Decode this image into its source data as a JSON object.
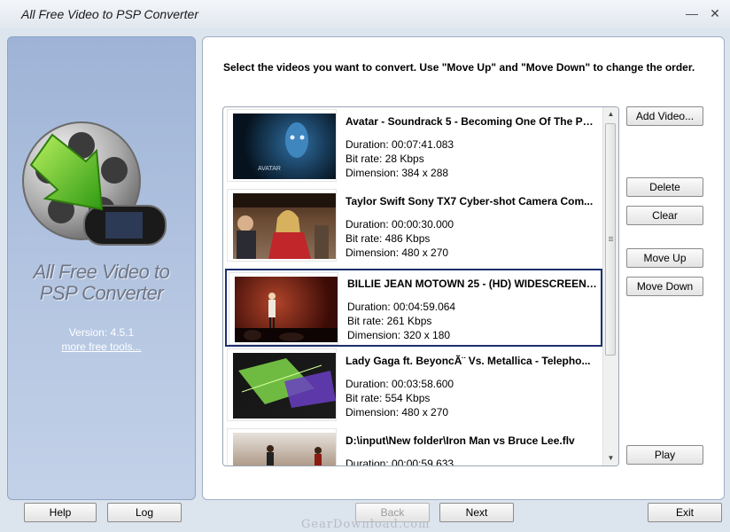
{
  "window": {
    "title": "All Free Video to PSP Converter",
    "minimize_label": "—",
    "close_label": "✕"
  },
  "sidebar": {
    "app_name_line1": "All Free Video to",
    "app_name_line2": "PSP Converter",
    "version": "Version: 4.5.1",
    "more_tools": "more free tools..."
  },
  "main": {
    "instructions": "Select the videos you want to convert. Use \"Move Up\" and \"Move Down\" to change the order."
  },
  "videos": [
    {
      "name": "Avatar - Soundrack 5 - Becoming One Of The Pe...",
      "duration": "Duration: 00:07:41.083",
      "bitrate": "Bit rate: 28 Kbps",
      "dimension": "Dimension: 384 x 288",
      "thumb_caption": "AVATAR"
    },
    {
      "name": "Taylor Swift Sony TX7 Cyber-shot Camera Com...",
      "duration": "Duration: 00:00:30.000",
      "bitrate": "Bit rate: 486 Kbps",
      "dimension": "Dimension: 480 x 270"
    },
    {
      "name": "BILLIE JEAN MOTOWN 25 -  (HD) WIDESCREEN.swf",
      "duration": "Duration: 00:04:59.064",
      "bitrate": "Bit rate: 261 Kbps",
      "dimension": "Dimension: 320 x 180",
      "selected": true
    },
    {
      "name": "Lady Gaga ft. BeyoncÃ¨ Vs. Metallica - Telepho...",
      "duration": "Duration: 00:03:58.600",
      "bitrate": "Bit rate: 554 Kbps",
      "dimension": "Dimension: 480 x 270"
    },
    {
      "name": "D:\\input\\New folder\\Iron Man vs Bruce Lee.flv",
      "duration": "Duration: 00:00:59.633",
      "bitrate": "",
      "dimension": ""
    }
  ],
  "buttons": {
    "add_video": "Add Video...",
    "delete": "Delete",
    "clear": "Clear",
    "move_up": "Move Up",
    "move_down": "Move Down",
    "play": "Play",
    "help": "Help",
    "log": "Log",
    "back": "Back",
    "next": "Next",
    "exit": "Exit"
  },
  "watermark": "GearDownload.com",
  "icons": {
    "logo": "film-reel-arrow-psp-icon",
    "scroll_up": "scroll-up-arrow-icon",
    "scroll_down": "scroll-down-arrow-icon"
  }
}
